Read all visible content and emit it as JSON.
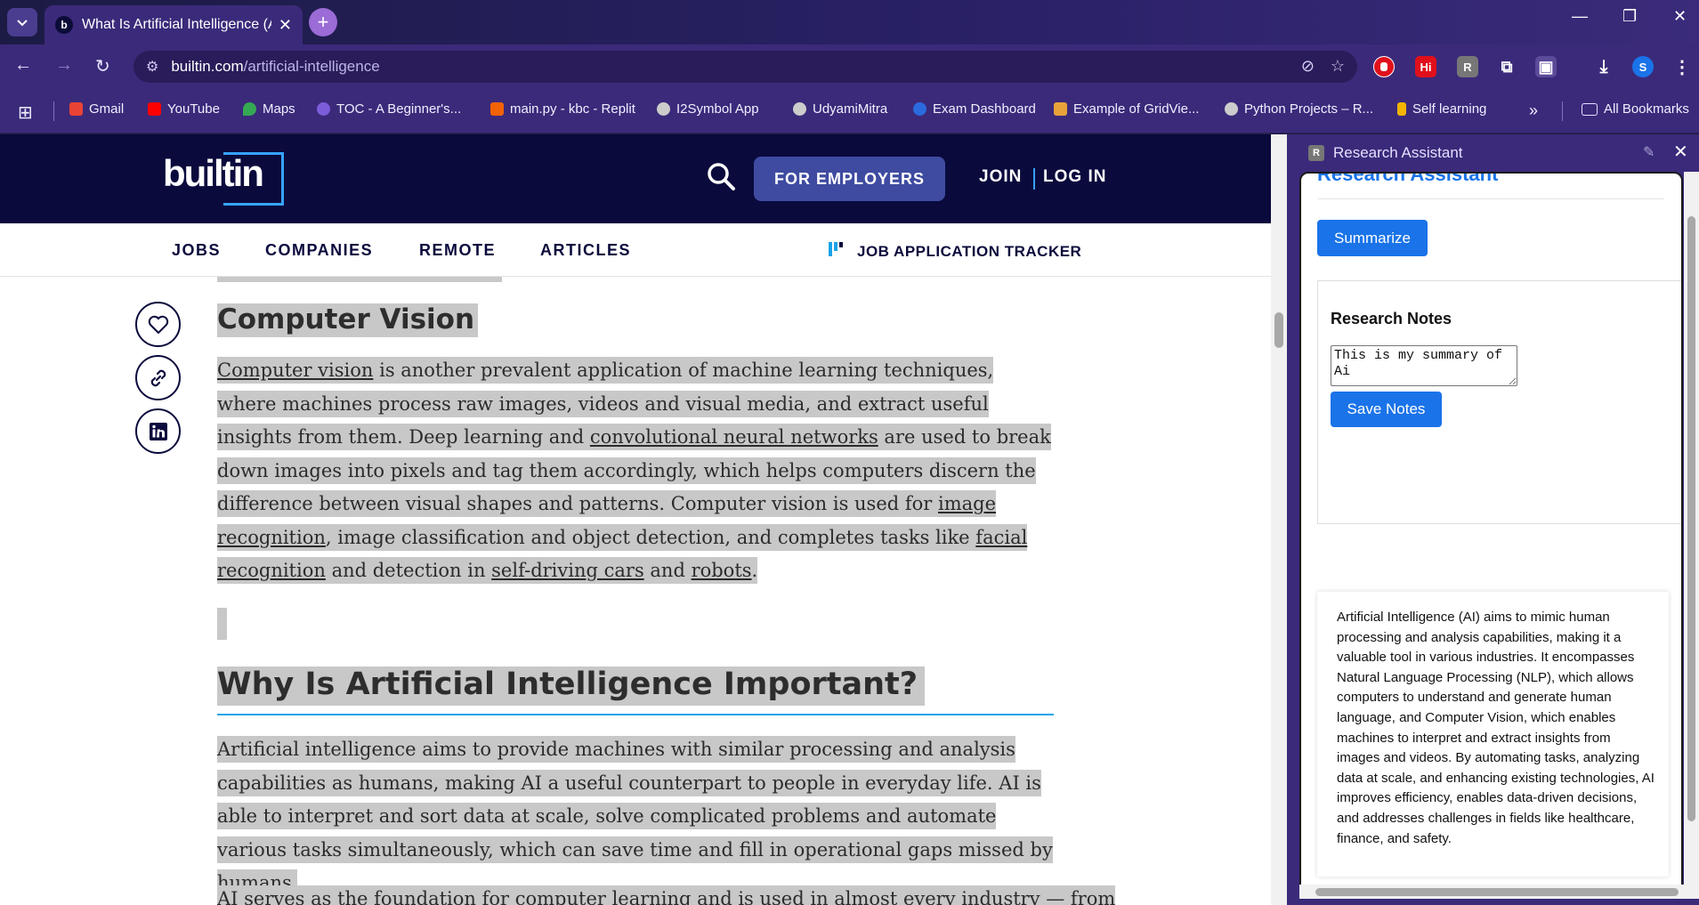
{
  "browser": {
    "tab_title": "What Is Artificial Intelligence (AI",
    "tab_favicon": "b",
    "url_domain": "builtin.com",
    "url_path": "/artificial-intelligence",
    "bookmarks": [
      {
        "label": "Gmail",
        "color": "#ea4335"
      },
      {
        "label": "YouTube",
        "color": "#ff0000"
      },
      {
        "label": "Maps",
        "color": "#34a853"
      },
      {
        "label": "TOC - A Beginner's...",
        "color": "#7c5cd8"
      },
      {
        "label": "main.py - kbc - Replit",
        "color": "#f26207"
      },
      {
        "label": "I2Symbol App",
        "color": "#cccccc"
      },
      {
        "label": "UdyamiMitra",
        "color": "#cccccc"
      },
      {
        "label": "Exam Dashboard",
        "color": "#2b6be0"
      },
      {
        "label": "Example of GridVie...",
        "color": "#e8a23a"
      },
      {
        "label": "Python Projects – R...",
        "color": "#cccccc"
      },
      {
        "label": "Self learning",
        "color": "#f4b400"
      }
    ],
    "all_bookmarks": "All Bookmarks",
    "more_bookmarks": "»"
  },
  "site": {
    "logo_text": "builtin",
    "employers_button": "FOR EMPLOYERS",
    "join": "JOIN",
    "login": "LOG IN",
    "nav": [
      "JOBS",
      "COMPANIES",
      "REMOTE",
      "ARTICLES"
    ],
    "tracker": "JOB APPLICATION TRACKER",
    "accent_color": "#1aa3e8"
  },
  "article": {
    "heading_cv": "Computer Vision",
    "cv_para": {
      "link1": "Computer vision",
      "t1": " is another prevalent application of machine learning techniques, where machines process raw images, videos and visual media, and extract useful insights from them. Deep learning and ",
      "link2": "convolutional neural networks",
      "t2": " are used to break down images into pixels and tag them accordingly, which helps computers discern the difference between visual shapes and patterns. Computer vision is used for ",
      "link3": "image recognition",
      "t3": ", image classification and object detection, and completes tasks like ",
      "link4": "facial recognition",
      "t4": " and detection in ",
      "link5": "self-driving cars",
      "t5": " and ",
      "link6": "robots",
      "t6": "."
    },
    "heading_why": "Why Is Artificial Intelligence Important?",
    "why_para": "Artificial intelligence aims to provide machines with similar processing and analysis capabilities as humans, making AI a useful counterpart to people in everyday life. AI is able to interpret and sort data at scale, solve complicated problems and automate various tasks simultaneously, which can save time and fill in operational gaps missed by humans.",
    "next_para": "AI serves as the foundation for computer learning and is used in almost every industry — from"
  },
  "panel": {
    "header_title": "Research Assistant",
    "header_favicon": "R",
    "body_title": "Research Assistant",
    "summarize_button": "Summarize",
    "notes_heading": "Research Notes",
    "notes_value": "This is my summary of Ai",
    "save_button": "Save Notes",
    "summary": "Artificial Intelligence (AI) aims to mimic human processing and analysis capabilities, making it a valuable tool in various industries. It encompasses Natural Language Processing (NLP), which allows computers to understand and generate human language, and Computer Vision, which enables machines to interpret and extract insights from images and videos. By automating tasks, analyzing data at scale, and enhancing existing technologies, AI improves efficiency, enables data-driven decisions, and addresses challenges in fields like healthcare, finance, and safety."
  }
}
